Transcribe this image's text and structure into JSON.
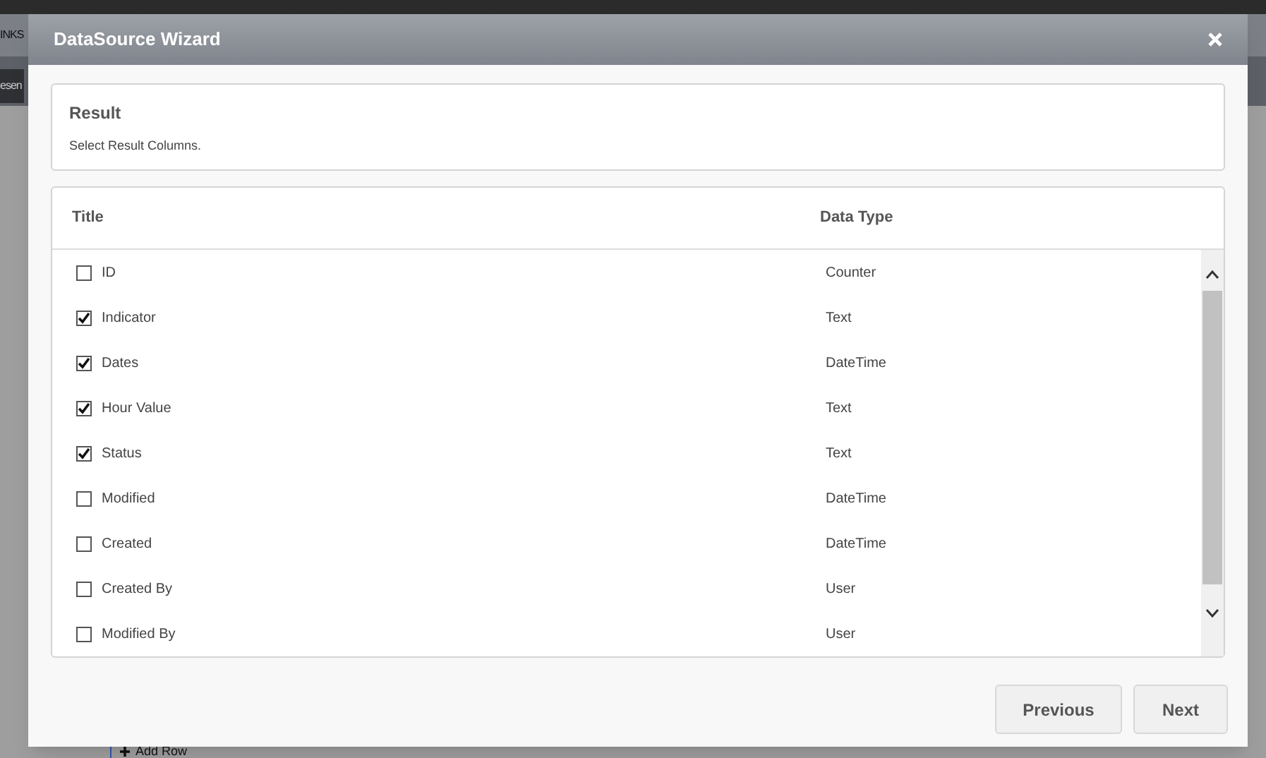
{
  "background": {
    "nav_label": "INKS",
    "tab_label": "esen",
    "add_row": "Add Row"
  },
  "dialog": {
    "title": "DataSource Wizard",
    "section": {
      "title": "Result",
      "description": "Select Result Columns."
    },
    "columns": [
      "Title",
      "Data Type"
    ],
    "rows": [
      {
        "title": "ID",
        "type": "Counter",
        "checked": false
      },
      {
        "title": "Indicator",
        "type": "Text",
        "checked": true
      },
      {
        "title": "Dates",
        "type": "DateTime",
        "checked": true
      },
      {
        "title": "Hour Value",
        "type": "Text",
        "checked": true
      },
      {
        "title": "Status",
        "type": "Text",
        "checked": true
      },
      {
        "title": "Modified",
        "type": "DateTime",
        "checked": false
      },
      {
        "title": "Created",
        "type": "DateTime",
        "checked": false
      },
      {
        "title": "Created By",
        "type": "User",
        "checked": false
      },
      {
        "title": "Modified By",
        "type": "User",
        "checked": false
      }
    ],
    "buttons": [
      "Previous",
      "Next"
    ]
  }
}
